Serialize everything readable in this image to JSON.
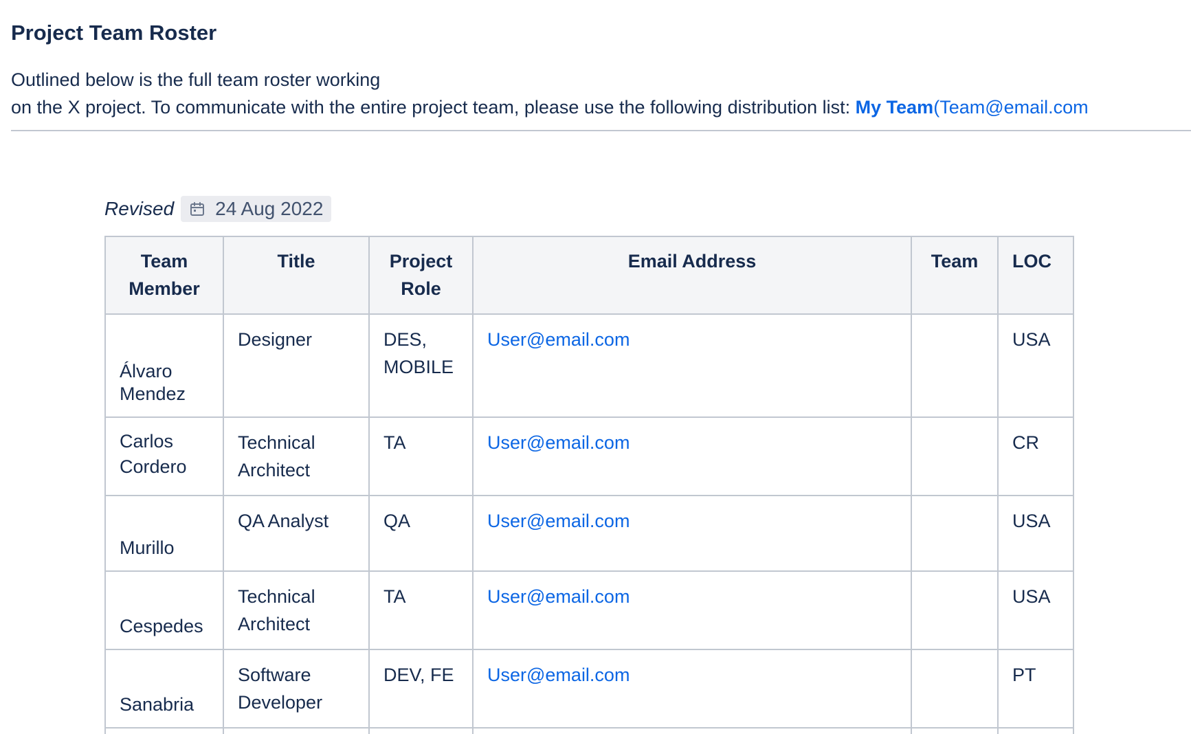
{
  "page": {
    "title": "Project Team Roster",
    "intro_line1": "Outlined below is the full team roster working",
    "intro_line2": "on the X project. To communicate with the entire project team, please use the following distribution list: ",
    "mention": "My Team",
    "distribution_email": "(Team@email.com"
  },
  "revised": {
    "label": "Revised",
    "date": "24 Aug 2022",
    "icon": "calendar-icon"
  },
  "table": {
    "headers": {
      "member": "Team Member",
      "title": "Title",
      "role": "Project Role",
      "email": "Email Address",
      "team": "Team",
      "loc": "LOC"
    },
    "rows": [
      {
        "member": "Álvaro Mendez",
        "title": "Designer",
        "role": "DES, MOBILE",
        "email": "User@email.com",
        "team": "",
        "loc": "USA"
      },
      {
        "member": "Carlos Cordero",
        "title": "Technical Architect",
        "role": "TA",
        "email": "User@email.com",
        "team": "",
        "loc": "CR"
      },
      {
        "member": "Murillo",
        "title": "QA Analyst",
        "role": "QA",
        "email": "User@email.com",
        "team": "",
        "loc": "USA"
      },
      {
        "member": "Cespedes",
        "title": "Technical Architect",
        "role": "TA",
        "email": "User@email.com",
        "team": "",
        "loc": "USA"
      },
      {
        "member": "Sanabria",
        "title": "Software Developer",
        "role": "DEV, FE",
        "email": "User@email.com",
        "team": "",
        "loc": "PT"
      }
    ]
  },
  "colors": {
    "text": "#172b4d",
    "link": "#0c66e4",
    "border": "#c1c7d0",
    "header_bg": "#f4f5f7",
    "lozenge_bg": "#ebecf0"
  }
}
